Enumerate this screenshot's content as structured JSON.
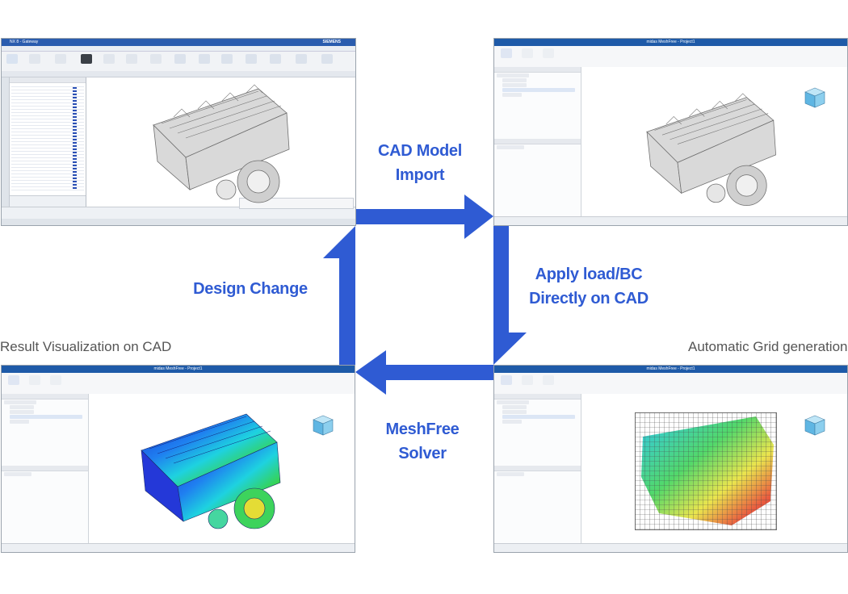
{
  "steps": {
    "cad_import": [
      "CAD Model",
      "Import"
    ],
    "apply_load": [
      "Apply load/BC",
      "Directly on CAD"
    ],
    "solver": [
      "MeshFree",
      "Solver"
    ],
    "design_change": "Design Change",
    "result_vis": "Result Visualization on CAD",
    "auto_grid": "Automatic Grid generation"
  },
  "colors": {
    "arrow": "#2f5bd3",
    "label": "#2f5bd3",
    "caption": "#555555",
    "titlebar": "#1e5aa8"
  },
  "windows": {
    "nx": {
      "title": "NX 8 - Gateway",
      "brand": "SIEMENS"
    },
    "midas": {
      "title": "midas MeshFree - Project1"
    }
  },
  "icons": [
    "engine-model-icon",
    "orientation-cube-icon",
    "flow-arrow-icon"
  ]
}
